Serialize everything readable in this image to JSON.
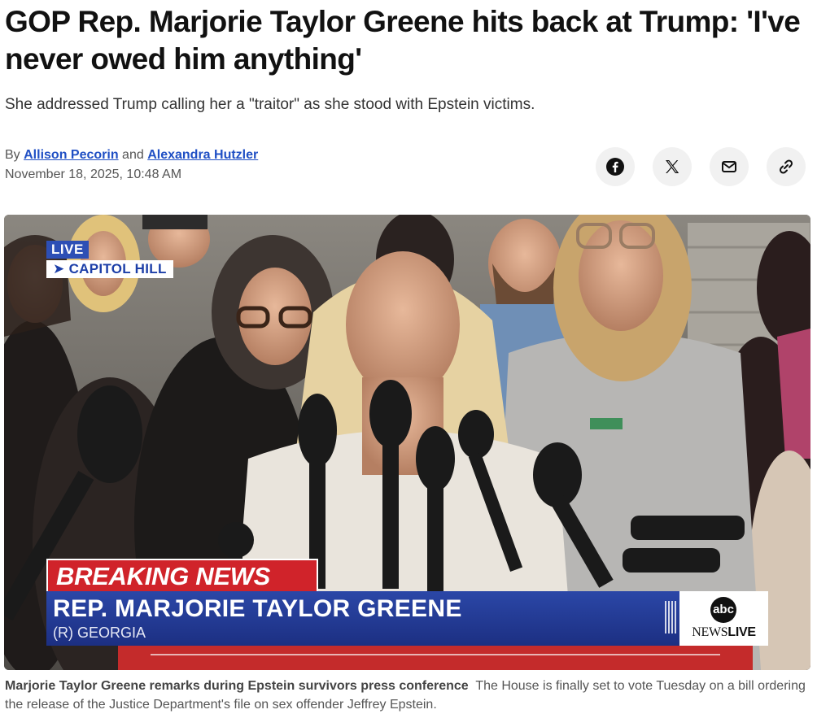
{
  "article": {
    "headline": "GOP Rep. Marjorie Taylor Greene hits back at Trump: 'I've never owed him anything'",
    "dek": "She addressed Trump calling her a \"traitor\" as she stood with Epstein victims.",
    "byline": {
      "prefix": "By",
      "author1": "Allison Pecorin",
      "joiner": "and",
      "author2": "Alexandra Hutzler"
    },
    "date": "November 18, 2025, 10:48 AM"
  },
  "share": {
    "icons": [
      "facebook-icon",
      "x-icon",
      "mail-icon",
      "link-icon"
    ]
  },
  "video": {
    "live_label": "LIVE",
    "location_label": "➤ CAPITOL HILL",
    "breaking_label": "BREAKING NEWS",
    "lower_third_name": "REP. MARJORIE TAYLOR GREENE",
    "lower_third_sub": "(R) GEORGIA",
    "logo_mark": "abc",
    "logo_news": "NEWS",
    "logo_live": "LIVE"
  },
  "caption": {
    "bold": "Marjorie Taylor Greene remarks during Epstein survivors press conference",
    "text": "The House is finally set to vote Tuesday on a bill ordering the release of the Justice Department's file on sex offender Jeffrey Epstein."
  },
  "colors": {
    "link": "#1f4fc4",
    "breaking_red": "#d0232a",
    "lower_third_blue": "#2b47a7",
    "share_bg": "#f1f1f1"
  }
}
